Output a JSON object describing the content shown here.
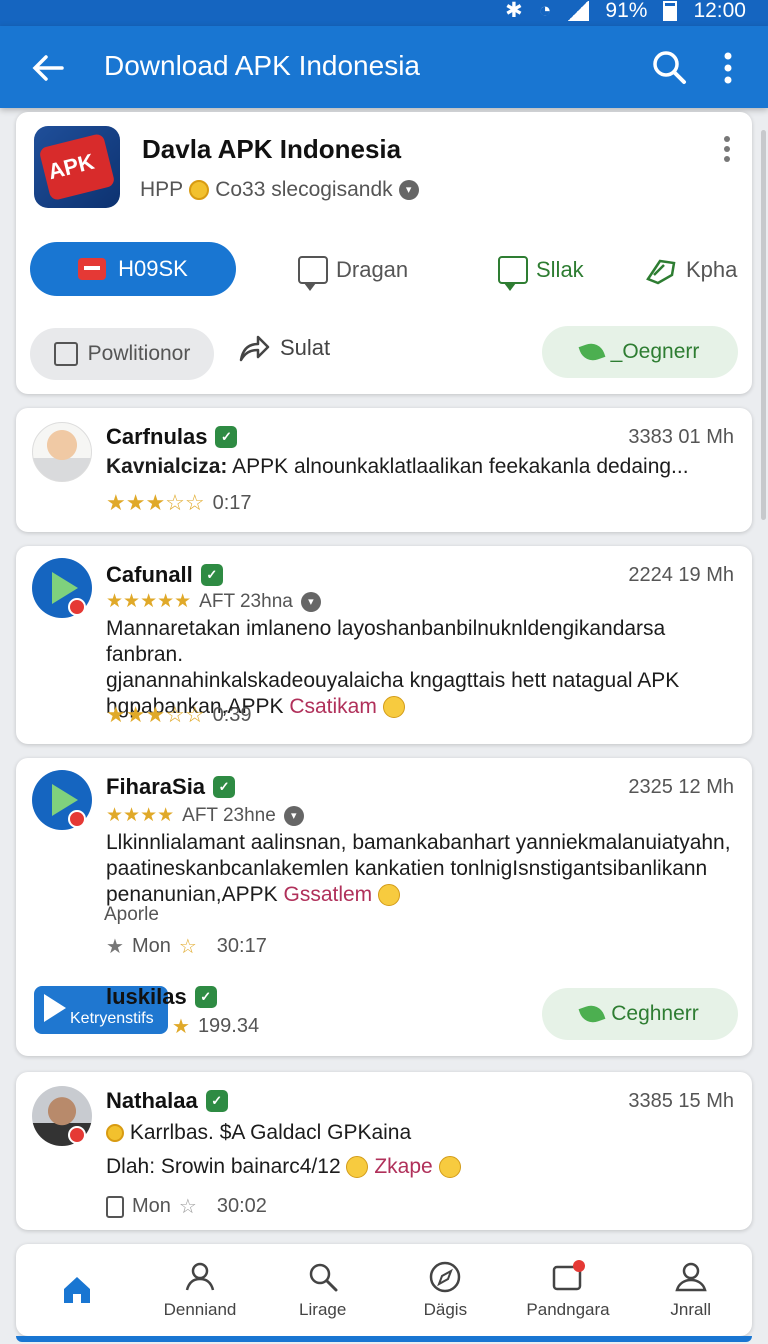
{
  "status": {
    "battery": "91%",
    "time": "12:00"
  },
  "appbar": {
    "title": "Download APK Indonesia",
    "icons": [
      "back-arrow-icon",
      "search-icon",
      "more-vert-icon"
    ]
  },
  "app": {
    "logo_text": "APK",
    "title": "Davla APK Indonesia",
    "sub_left": "HPP",
    "sub_right": "Co33 slecogisandk",
    "primary_button": "H09SK",
    "actions": [
      "Dragan",
      "Sllak",
      "Kpha"
    ],
    "grey_button": "Powlitionor",
    "share": "Sulat",
    "green_button": "_Oegnerr"
  },
  "reviews": [
    {
      "name": "Carfnulas",
      "time": "3383 01 Mh",
      "text_bold": "Kavnialciza:",
      "text": "APPK alnounkaklatlaalikan feekakanla dedaing...",
      "stars": "★★★☆☆",
      "duration": "0:17"
    },
    {
      "name": "Cafunall",
      "time": "2224 19 Mh",
      "sub_stars": "★★★★★",
      "sub_text": "AFT 23hna",
      "line1": "Mannaretakan imlaneno layoshanbanbilnuknldengikandarsa fanbran.",
      "line2": "gjanannahinkalskadeouyalaicha kngagttais hett natagual APK",
      "line3": "hgpabankan,APPK",
      "highlight": "Csatikam",
      "stars": "★★★☆☆",
      "duration": "0:39"
    },
    {
      "name": "FiharaSia",
      "time": "2325 12 Mh",
      "sub_stars": "★★★★",
      "sub_text": "AFT 23hne",
      "line1": "Llkinnlialamant aalinsnan, bamankabanhart yanniekmalanuiatyahn,",
      "line2": "paatineskanbcanlakemlen kankatien tonlnigIsnstigantsibanlikann",
      "line3": "penanunian,APPK",
      "highlight": "Gssatlem",
      "extra": "Aporle",
      "day": "Mon",
      "duration": "30:17",
      "promo_label": "Ketryenstifs",
      "promo_name": "luskilas",
      "promo_rating": "199.34",
      "green_button": "Ceghnerr"
    },
    {
      "name": "Nathalaa",
      "time": "3385 15 Mh",
      "sub_text": "Karrlbas. $A Galdacl GPKaina",
      "line1": "Dlah: Srowin bainarc4/12",
      "highlight": "Zkape",
      "day": "Mon",
      "duration": "30:02"
    }
  ],
  "bottomnav": [
    {
      "label": "Denniand",
      "icon": "home-icon"
    },
    {
      "label": "Lirage",
      "icon": "people-icon"
    },
    {
      "label": "Dägis",
      "icon": "search-icon"
    },
    {
      "label": "",
      "icon": "compass-icon"
    },
    {
      "label": "Pandngara",
      "icon": "apk-badge-icon"
    },
    {
      "label": "Jnrall",
      "icon": "person-icon"
    }
  ],
  "colors": {
    "primary": "#1976d2",
    "green": "#2e7d32",
    "star": "#e0a929"
  }
}
